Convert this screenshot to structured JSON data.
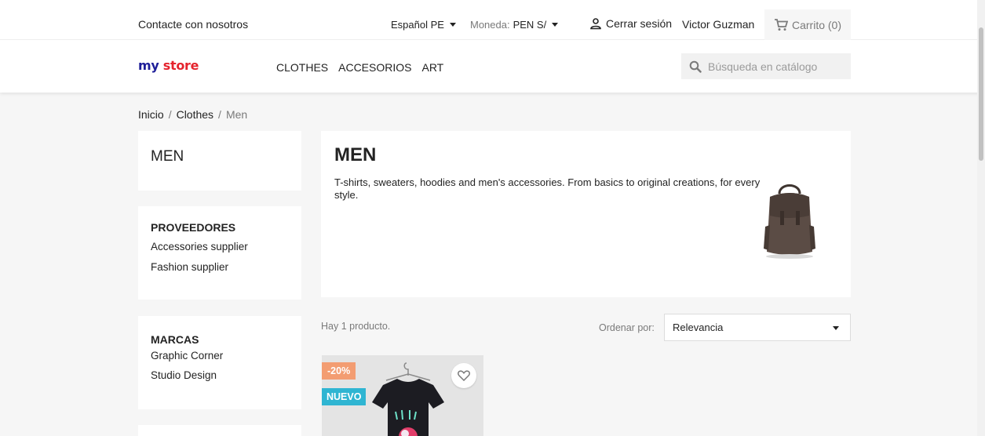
{
  "topbar": {
    "contact": "Contacte con nosotros",
    "language": "Español PE",
    "currency_label": "Moneda:",
    "currency_value": "PEN S/",
    "logout": "Cerrar sesión",
    "username": "Victor Guzman",
    "cart": "Carrito (0)"
  },
  "logo": {
    "part1": "my",
    "part2": "store"
  },
  "menu": {
    "items": [
      "CLOTHES",
      "ACCESORIOS",
      "ART"
    ]
  },
  "search": {
    "placeholder": "Búsqueda en catálogo"
  },
  "breadcrumb": {
    "items": [
      "Inicio",
      "Clothes",
      "Men"
    ],
    "separator": "/"
  },
  "sidebar": {
    "category_title": "MEN",
    "suppliers": {
      "title": "PROVEEDORES",
      "items": [
        "Accessories supplier",
        "Fashion supplier"
      ]
    },
    "brands": {
      "title": "MARCAS",
      "items": [
        "Graphic Corner",
        "Studio Design"
      ]
    }
  },
  "category": {
    "title": "MEN",
    "description": "T-shirts, sweaters, hoodies and men's accessories. From basics to original creations, for every style."
  },
  "products": {
    "count_text": "Hay 1 producto.",
    "sort_label": "Ordenar por:",
    "sort_value": "Relevancia",
    "items": [
      {
        "discount": "-20%",
        "flag": "NUEVO"
      }
    ]
  },
  "colors": {
    "accent": "#2fb5d2",
    "discount": "#f39d72",
    "logo_blue": "#1e1e99",
    "logo_red": "#e5232d"
  },
  "icons": [
    "caret-down-icon",
    "user-icon",
    "cart-icon",
    "search-icon",
    "heart-icon"
  ]
}
